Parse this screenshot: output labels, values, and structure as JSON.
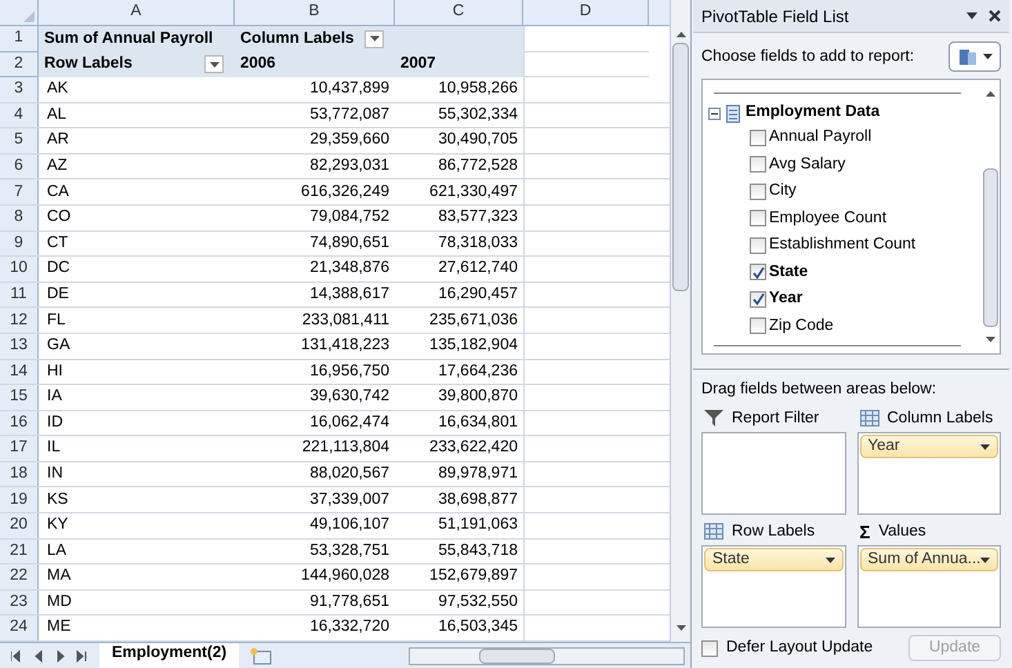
{
  "sheet": {
    "columns": [
      "A",
      "B",
      "C",
      "D"
    ],
    "header_rows": [
      {
        "number": "1",
        "cells": [
          {
            "text": "Sum of Annual Payroll",
            "filter": false
          },
          {
            "text": "Column Labels",
            "filter": true
          }
        ]
      },
      {
        "number": "2",
        "cells": [
          {
            "text": "Row Labels",
            "filter": true
          },
          {
            "text": "2006",
            "filter": false
          },
          {
            "text": "2007",
            "filter": false
          }
        ]
      }
    ],
    "rows": [
      {
        "number": "3",
        "cells": [
          "AK",
          "10,437,899",
          "10,958,266"
        ]
      },
      {
        "number": "4",
        "cells": [
          "AL",
          "53,772,087",
          "55,302,334"
        ]
      },
      {
        "number": "5",
        "cells": [
          "AR",
          "29,359,660",
          "30,490,705"
        ]
      },
      {
        "number": "6",
        "cells": [
          "AZ",
          "82,293,031",
          "86,772,528"
        ]
      },
      {
        "number": "7",
        "cells": [
          "CA",
          "616,326,249",
          "621,330,497"
        ]
      },
      {
        "number": "8",
        "cells": [
          "CO",
          "79,084,752",
          "83,577,323"
        ]
      },
      {
        "number": "9",
        "cells": [
          "CT",
          "74,890,651",
          "78,318,033"
        ]
      },
      {
        "number": "10",
        "cells": [
          "DC",
          "21,348,876",
          "27,612,740"
        ]
      },
      {
        "number": "11",
        "cells": [
          "DE",
          "14,388,617",
          "16,290,457"
        ]
      },
      {
        "number": "12",
        "cells": [
          "FL",
          "233,081,411",
          "235,671,036"
        ]
      },
      {
        "number": "13",
        "cells": [
          "GA",
          "131,418,223",
          "135,182,904"
        ]
      },
      {
        "number": "14",
        "cells": [
          "HI",
          "16,956,750",
          "17,664,236"
        ]
      },
      {
        "number": "15",
        "cells": [
          "IA",
          "39,630,742",
          "39,800,870"
        ]
      },
      {
        "number": "16",
        "cells": [
          "ID",
          "16,062,474",
          "16,634,801"
        ]
      },
      {
        "number": "17",
        "cells": [
          "IL",
          "221,113,804",
          "233,622,420"
        ]
      },
      {
        "number": "18",
        "cells": [
          "IN",
          "88,020,567",
          "89,978,971"
        ]
      },
      {
        "number": "19",
        "cells": [
          "KS",
          "37,339,007",
          "38,698,877"
        ]
      },
      {
        "number": "20",
        "cells": [
          "KY",
          "49,106,107",
          "51,191,063"
        ]
      },
      {
        "number": "21",
        "cells": [
          "LA",
          "53,328,751",
          "55,843,718"
        ]
      },
      {
        "number": "22",
        "cells": [
          "MA",
          "144,960,028",
          "152,679,897"
        ]
      },
      {
        "number": "23",
        "cells": [
          "MD",
          "91,778,651",
          "97,532,550"
        ]
      },
      {
        "number": "24",
        "cells": [
          "ME",
          "16,332,720",
          "16,503,345"
        ]
      }
    ],
    "tabs": [
      {
        "label": "Employment(2)",
        "selected": true
      }
    ]
  },
  "panel": {
    "title": "PivotTable Field List",
    "choose_label": "Choose fields to add to report:",
    "table_name": "Employment Data",
    "fields": [
      {
        "label": "Annual Payroll",
        "checked": false
      },
      {
        "label": "Avg Salary",
        "checked": false
      },
      {
        "label": "City",
        "checked": false
      },
      {
        "label": "Employee Count",
        "checked": false
      },
      {
        "label": "Establishment Count",
        "checked": false
      },
      {
        "label": "State",
        "checked": true
      },
      {
        "label": "Year",
        "checked": true
      },
      {
        "label": "Zip Code",
        "checked": false
      }
    ],
    "drag_label": "Drag fields between areas below:",
    "areas": [
      {
        "kind": "filter",
        "label": "Report Filter"
      },
      {
        "kind": "columns",
        "label": "Column Labels",
        "items": [
          "Year"
        ]
      },
      {
        "kind": "rows",
        "label": "Row Labels",
        "items": [
          "State"
        ]
      },
      {
        "kind": "values",
        "label": "Values",
        "icon": "Σ",
        "items": [
          "Sum of Annua..."
        ]
      }
    ],
    "defer": {
      "label": "Defer Layout Update",
      "checked": false
    },
    "update_button": {
      "label": "Update",
      "disabled": true
    }
  }
}
